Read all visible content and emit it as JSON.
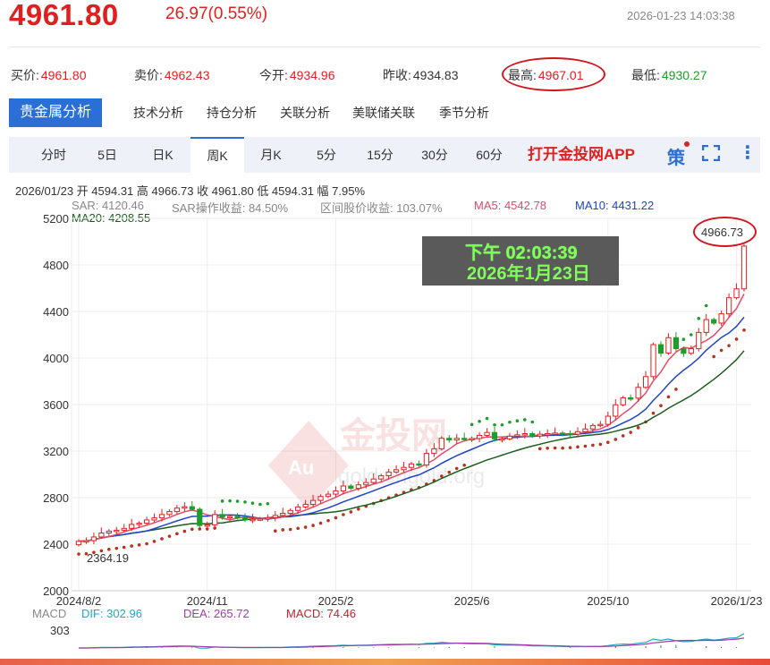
{
  "quote": {
    "price": "4961.80",
    "change": "26.97(0.55%)",
    "timestamp": "2026-01-23 14:03:38",
    "bid_label": "买价:",
    "bid": "4961.80",
    "ask_label": "卖价:",
    "ask": "4962.43",
    "open_label": "今开:",
    "open": "4934.96",
    "prev_label": "昨收:",
    "prev": "4934.83",
    "high_label": "最高:",
    "high": "4967.01",
    "low_label": "最低:",
    "low": "4930.27"
  },
  "nav_tabs": [
    "贵金属分析",
    "技术分析",
    "持仓分析",
    "关联分析",
    "美联储关联",
    "季节分析"
  ],
  "period_tabs": [
    "分时",
    "5日",
    "日K",
    "周K",
    "月K",
    "5分",
    "15分",
    "30分",
    "60分"
  ],
  "active_period": "周K",
  "app_link": "打开金投网APP",
  "icons": {
    "strategy": "策",
    "fullscreen": "fullscreen-icon",
    "more": "more-icon"
  },
  "ohlc_line": "2026/01/23  开 4594.31  高 4966.73  收 4961.80  低 4594.31  幅 7.95%",
  "indicators": {
    "sar": "SAR: 4120.46",
    "sar_gain": "SAR操作收益: 84.50%",
    "range_gain": "区间股价收益: 103.07%",
    "ma5": "MA5: 4542.78",
    "ma10": "MA10: 4431.22",
    "ma20": "MA20: 4208.55"
  },
  "tooltip": {
    "line1": "下午 02:03:39",
    "line2": "2026年1月23日"
  },
  "watermark": {
    "brand": "金投网",
    "url": "gold.cngold.org",
    "logo_text": "Au"
  },
  "max_label": "4966.73",
  "min_label": "2364.19",
  "macd": {
    "label": "MACD",
    "dif": "DIF: 302.96",
    "dea": "DEA: 265.72",
    "macd": "MACD: 74.46",
    "scale": "303"
  },
  "colors": {
    "up": "#e0201f",
    "down": "#1f9d2c",
    "ma5": "#e44a6a",
    "ma10": "#2044c8",
    "ma20": "#1d5e1d",
    "sar_below": "#b8321e",
    "sar_above": "#1f9d2c"
  },
  "chart_data": {
    "type": "candlestick",
    "title": "",
    "ylim": [
      2000,
      5200
    ],
    "yticks": [
      2000,
      2400,
      2800,
      3200,
      3600,
      4000,
      4400,
      4800,
      5200
    ],
    "xticks": [
      "2024/8/2",
      "2024/11",
      "2025/2",
      "2025/6",
      "2025/10",
      "2026/1/23"
    ],
    "xtick_index": [
      0,
      17,
      34,
      52,
      70,
      87
    ],
    "grid": true,
    "close": [
      2425,
      2430,
      2462,
      2496,
      2512,
      2520,
      2536,
      2570,
      2580,
      2608,
      2626,
      2655,
      2680,
      2710,
      2722,
      2700,
      2560,
      2566,
      2655,
      2632,
      2638,
      2628,
      2612,
      2613,
      2617,
      2628,
      2647,
      2665,
      2690,
      2720,
      2742,
      2776,
      2810,
      2830,
      2858,
      2900,
      2880,
      2910,
      2930,
      2960,
      2988,
      3020,
      3040,
      3060,
      3090,
      3080,
      3180,
      3220,
      3310,
      3295,
      3310,
      3300,
      3308,
      3335,
      3360,
      3305,
      3305,
      3328,
      3340,
      3350,
      3330,
      3345,
      3350,
      3355,
      3350,
      3345,
      3367,
      3390,
      3420,
      3430,
      3500,
      3598,
      3658,
      3655,
      3748,
      3840,
      4115,
      4042,
      4175,
      4080,
      4040,
      4080,
      4220,
      4330,
      4300,
      4380,
      4518,
      4594,
      4962
    ],
    "series": [
      {
        "name": "MA5",
        "value": 4542.78
      },
      {
        "name": "MA10",
        "value": 4431.22
      },
      {
        "name": "MA20",
        "value": 4208.55
      },
      {
        "name": "SAR",
        "value": 4120.46
      }
    ],
    "macd": {
      "dif": 302.96,
      "dea": 265.72,
      "macd": 74.46
    }
  }
}
